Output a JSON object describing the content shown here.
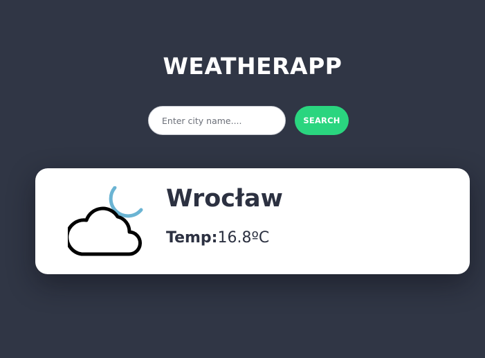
{
  "header": {
    "title": "WEATHERAPP"
  },
  "search": {
    "placeholder": "Enter city name....",
    "value": "",
    "button_label": "SEARCH"
  },
  "weather": {
    "city": "Wrocław",
    "temp_label": "Temp:",
    "temp_value": "16.8ºC",
    "icon": "partly-cloudy-night-icon"
  },
  "colors": {
    "background": "#303645",
    "card": "#ffffff",
    "accent": "#2ad57f",
    "text_dark": "#2c3141",
    "moon": "#6bb4d3"
  }
}
